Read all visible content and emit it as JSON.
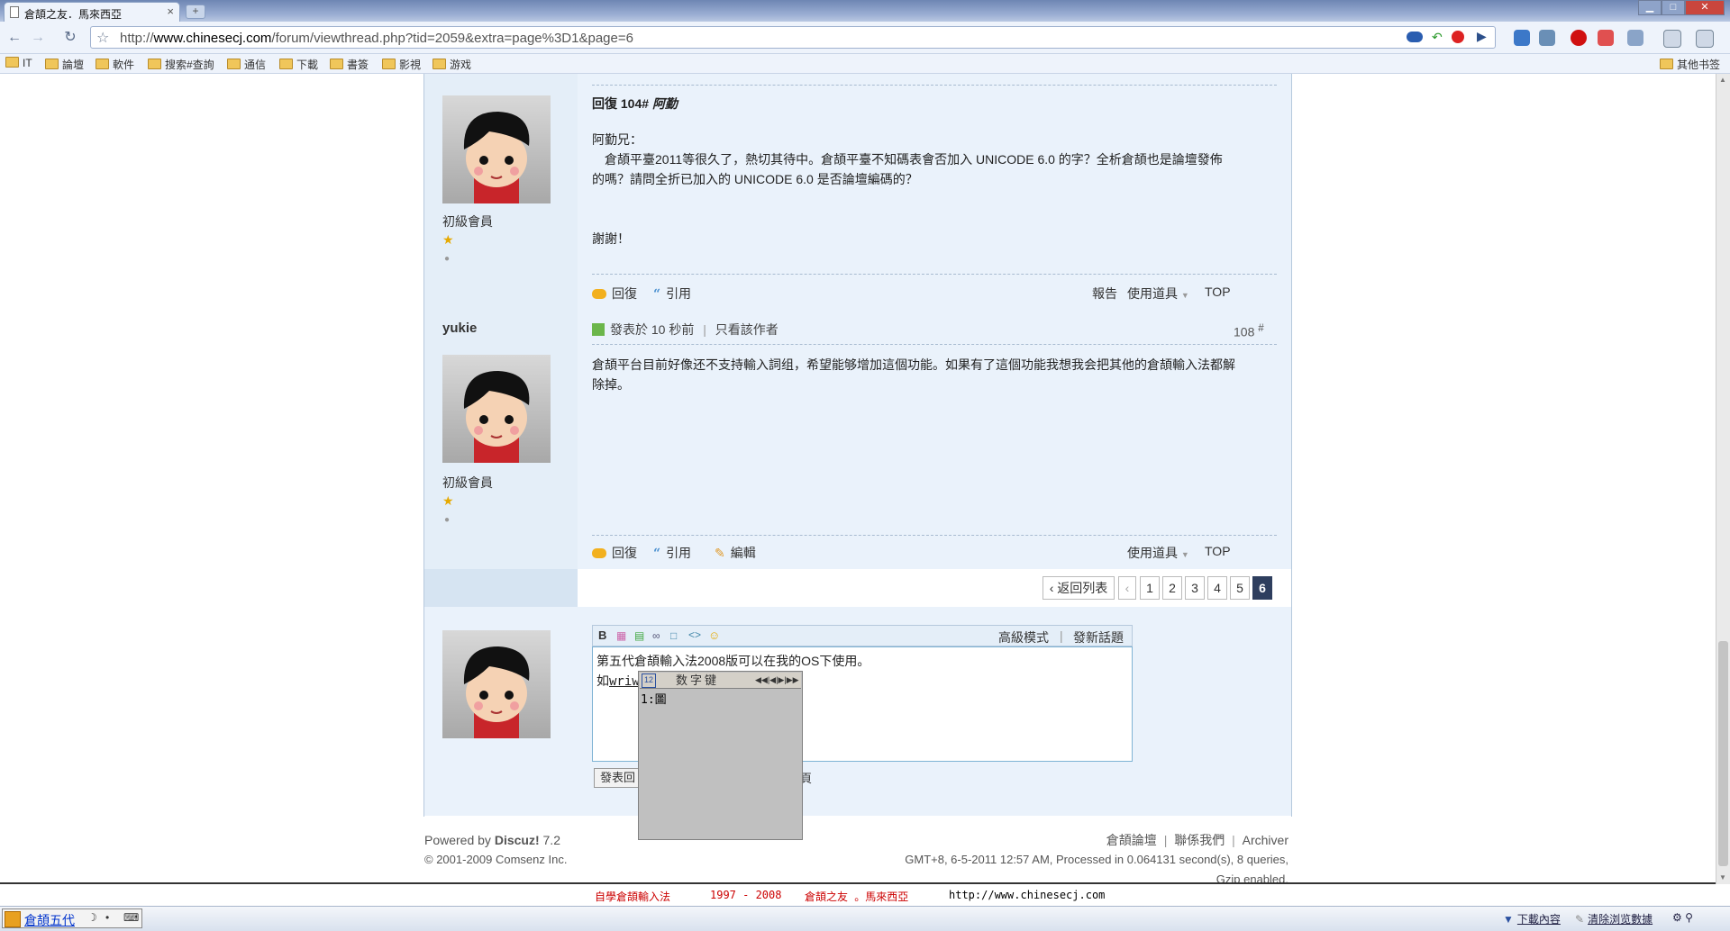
{
  "browser": {
    "tab_title": "倉頡之友．馬來西亞",
    "tab_close": "×",
    "new_tab": "+",
    "url_prefix": "http://",
    "url_domain": "www.chinesecj.com",
    "url_path": "/forum/viewthread.php?tid=2059&extra=page%3D1&page=6",
    "window_buttons": {
      "minimize": "▁",
      "maximize": "□",
      "close": "✕"
    }
  },
  "bookmarks": {
    "items": [
      "IT",
      "論壇",
      "軟件",
      "搜索#查詢",
      "通信",
      "下載",
      "書簽",
      "影視",
      "游戏"
    ],
    "other": "其他书签"
  },
  "posts": [
    {
      "rank": "初級會員",
      "reply_title": "回復 104#",
      "reply_to": "阿勤",
      "body": [
        "阿勤兄：",
        "　倉頡平臺2011等很久了，熱切其待中。倉頡平臺不知碼表會否加入 UNICODE 6.0 的字？全析倉頡也是論壇發佈",
        "的嗎？請問全折已加入的 UNICODE 6.0 是否論壇編碼的？",
        "",
        "謝謝！"
      ],
      "actions": {
        "reply": "回復",
        "quote": "引用",
        "report": "報告",
        "tools": "使用道具",
        "top": "TOP"
      }
    },
    {
      "author": "yukie",
      "rank": "初級會員",
      "posted_at": "發表於 10 秒前",
      "separator": "|",
      "only_author": "只看該作者",
      "floor": "108",
      "floor_suffix": "#",
      "body": [
        "倉頡平台目前好像还不支持輸入詞组，希望能够增加這個功能。如果有了這個功能我想我会把其他的倉頡輸入法都解",
        "除掉。"
      ],
      "actions": {
        "reply": "回復",
        "quote": "引用",
        "edit": "編輯",
        "tools": "使用道具",
        "top": "TOP"
      }
    }
  ],
  "pager": {
    "back": "‹ 返回列表",
    "prev": "‹",
    "pages": [
      "1",
      "2",
      "3",
      "4",
      "5",
      "6"
    ],
    "current": "6"
  },
  "editor": {
    "advanced": "高級模式",
    "new_topic": "發新話題",
    "separator": "|",
    "line1": "第五代倉頡輸入法2008版可以在我的OS下使用。",
    "line2_prefix": "如",
    "line2_composition": "wriw",
    "submit": "發表回",
    "trailing_fragment": "頁"
  },
  "ime_popup": {
    "title": "数字键",
    "candidate": "1:圖",
    "nav": "◀◀|◀|▶|▶▶"
  },
  "footer": {
    "powered_by": "Powered by",
    "brand": "Discuz!",
    "version": "7.2",
    "copyright": "© 2001-2009 Comsenz Inc.",
    "links": [
      "倉頡論壇",
      "聯係我們",
      "Archiver"
    ],
    "stats": "GMT+8, 6-5-2011 12:57 AM, Processed in 0.064131 second(s), 8 queries, Gzip enabled."
  },
  "bottom_strip": {
    "items": [
      "自學倉頡輸入法",
      "1997 - 2008",
      "倉頡之友 。馬來西亞",
      "http://www.chinesecj.com"
    ]
  },
  "statusbar": {
    "ime_name": "倉頡五代",
    "downloads": "下載內容",
    "clear": "清除浏览數據"
  }
}
